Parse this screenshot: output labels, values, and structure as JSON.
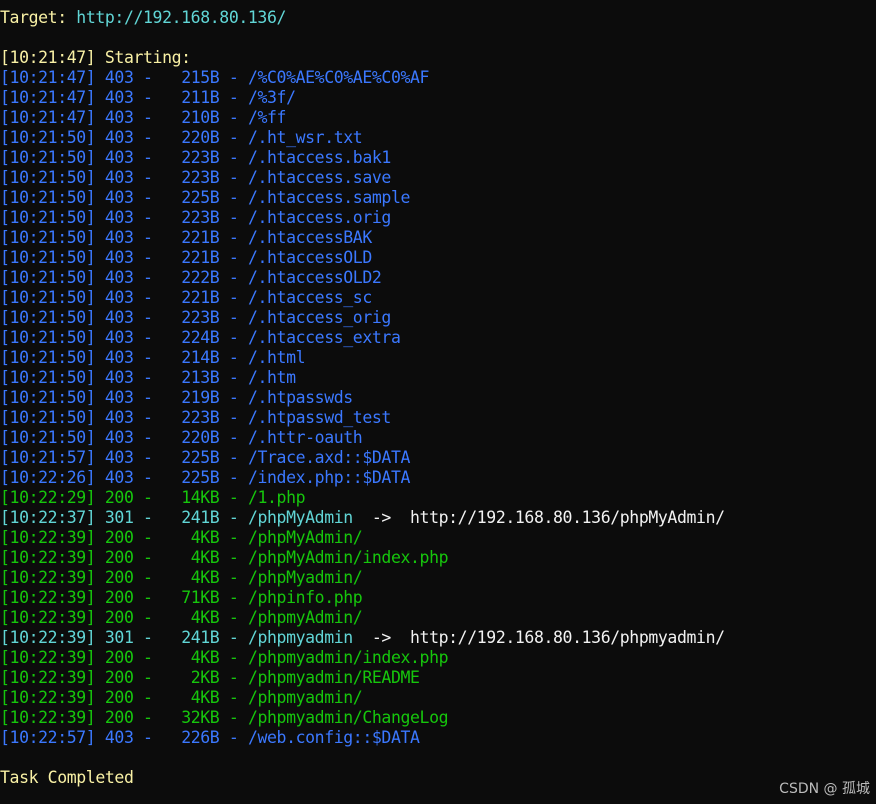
{
  "header": {
    "target_label": "Target: ",
    "target_url": "http://192.168.80.136/"
  },
  "start": {
    "timestamp": "[10:21:47]",
    "text": " Starting:"
  },
  "results": [
    {
      "time": "[10:21:47]",
      "status": "403",
      "size": "215B",
      "path": "/%C0%AE%C0%AE%C0%AF",
      "redirect": ""
    },
    {
      "time": "[10:21:47]",
      "status": "403",
      "size": "211B",
      "path": "/%3f/",
      "redirect": ""
    },
    {
      "time": "[10:21:47]",
      "status": "403",
      "size": "210B",
      "path": "/%ff",
      "redirect": ""
    },
    {
      "time": "[10:21:50]",
      "status": "403",
      "size": "220B",
      "path": "/.ht_wsr.txt",
      "redirect": ""
    },
    {
      "time": "[10:21:50]",
      "status": "403",
      "size": "223B",
      "path": "/.htaccess.bak1",
      "redirect": ""
    },
    {
      "time": "[10:21:50]",
      "status": "403",
      "size": "223B",
      "path": "/.htaccess.save",
      "redirect": ""
    },
    {
      "time": "[10:21:50]",
      "status": "403",
      "size": "225B",
      "path": "/.htaccess.sample",
      "redirect": ""
    },
    {
      "time": "[10:21:50]",
      "status": "403",
      "size": "223B",
      "path": "/.htaccess.orig",
      "redirect": ""
    },
    {
      "time": "[10:21:50]",
      "status": "403",
      "size": "221B",
      "path": "/.htaccessBAK",
      "redirect": ""
    },
    {
      "time": "[10:21:50]",
      "status": "403",
      "size": "221B",
      "path": "/.htaccessOLD",
      "redirect": ""
    },
    {
      "time": "[10:21:50]",
      "status": "403",
      "size": "222B",
      "path": "/.htaccessOLD2",
      "redirect": ""
    },
    {
      "time": "[10:21:50]",
      "status": "403",
      "size": "221B",
      "path": "/.htaccess_sc",
      "redirect": ""
    },
    {
      "time": "[10:21:50]",
      "status": "403",
      "size": "223B",
      "path": "/.htaccess_orig",
      "redirect": ""
    },
    {
      "time": "[10:21:50]",
      "status": "403",
      "size": "224B",
      "path": "/.htaccess_extra",
      "redirect": ""
    },
    {
      "time": "[10:21:50]",
      "status": "403",
      "size": "214B",
      "path": "/.html",
      "redirect": ""
    },
    {
      "time": "[10:21:50]",
      "status": "403",
      "size": "213B",
      "path": "/.htm",
      "redirect": ""
    },
    {
      "time": "[10:21:50]",
      "status": "403",
      "size": "219B",
      "path": "/.htpasswds",
      "redirect": ""
    },
    {
      "time": "[10:21:50]",
      "status": "403",
      "size": "223B",
      "path": "/.htpasswd_test",
      "redirect": ""
    },
    {
      "time": "[10:21:50]",
      "status": "403",
      "size": "220B",
      "path": "/.httr-oauth",
      "redirect": ""
    },
    {
      "time": "[10:21:57]",
      "status": "403",
      "size": "225B",
      "path": "/Trace.axd::$DATA",
      "redirect": ""
    },
    {
      "time": "[10:22:26]",
      "status": "403",
      "size": "225B",
      "path": "/index.php::$DATA",
      "redirect": ""
    },
    {
      "time": "[10:22:29]",
      "status": "200",
      "size": "14KB",
      "path": "/1.php",
      "redirect": ""
    },
    {
      "time": "[10:22:37]",
      "status": "301",
      "size": "241B",
      "path": "/phpMyAdmin",
      "redirect": "http://192.168.80.136/phpMyAdmin/"
    },
    {
      "time": "[10:22:39]",
      "status": "200",
      "size": "4KB",
      "path": "/phpMyAdmin/",
      "redirect": ""
    },
    {
      "time": "[10:22:39]",
      "status": "200",
      "size": "4KB",
      "path": "/phpMyAdmin/index.php",
      "redirect": ""
    },
    {
      "time": "[10:22:39]",
      "status": "200",
      "size": "4KB",
      "path": "/phpMyadmin/",
      "redirect": ""
    },
    {
      "time": "[10:22:39]",
      "status": "200",
      "size": "71KB",
      "path": "/phpinfo.php",
      "redirect": ""
    },
    {
      "time": "[10:22:39]",
      "status": "200",
      "size": "4KB",
      "path": "/phpmyAdmin/",
      "redirect": ""
    },
    {
      "time": "[10:22:39]",
      "status": "301",
      "size": "241B",
      "path": "/phpmyadmin",
      "redirect": "http://192.168.80.136/phpmyadmin/"
    },
    {
      "time": "[10:22:39]",
      "status": "200",
      "size": "4KB",
      "path": "/phpmyadmin/index.php",
      "redirect": ""
    },
    {
      "time": "[10:22:39]",
      "status": "200",
      "size": "2KB",
      "path": "/phpmyadmin/README",
      "redirect": ""
    },
    {
      "time": "[10:22:39]",
      "status": "200",
      "size": "4KB",
      "path": "/phpmyadmin/",
      "redirect": ""
    },
    {
      "time": "[10:22:39]",
      "status": "200",
      "size": "32KB",
      "path": "/phpmyadmin/ChangeLog",
      "redirect": ""
    },
    {
      "time": "[10:22:57]",
      "status": "403",
      "size": "226B",
      "path": "/web.config::$DATA",
      "redirect": ""
    }
  ],
  "footer": {
    "task_completed": "Task Completed"
  },
  "watermark": "CSDN @ 孤城",
  "colors": {
    "background": "#0c0c0c",
    "status_403": "#3b78ff",
    "status_200": "#16c60c",
    "status_301": "#61d6d6",
    "header_yellow": "#f9f1a5",
    "url_cyan": "#61d6d6"
  }
}
